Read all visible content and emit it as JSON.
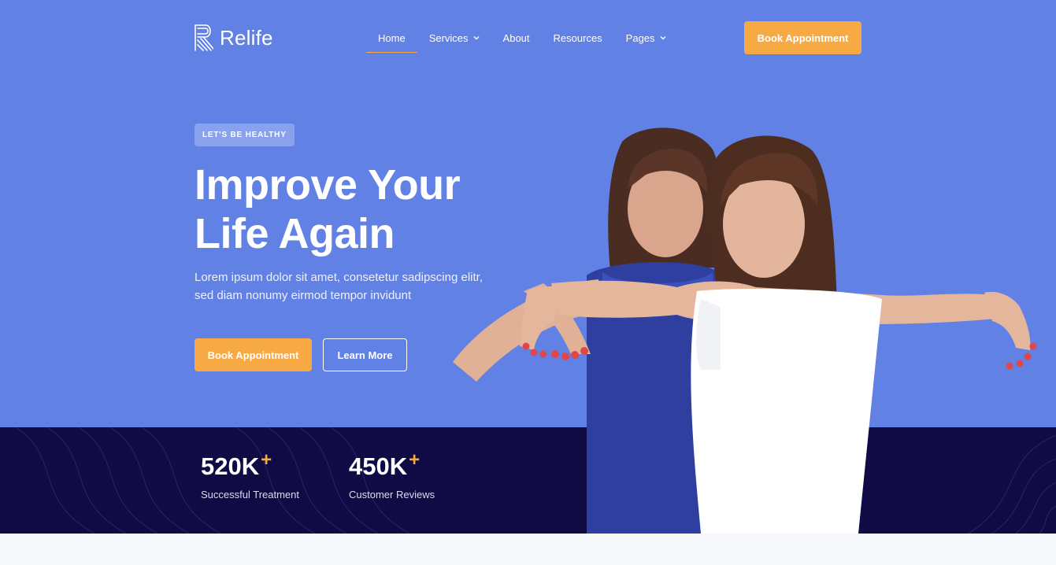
{
  "brand": {
    "name": "Relife",
    "logo_icon": "relife-logo-icon"
  },
  "nav": {
    "home": "Home",
    "services": "Services",
    "about": "About",
    "resources": "Resources",
    "pages": "Pages"
  },
  "header": {
    "cta": "Book Appointment"
  },
  "hero": {
    "badge": "LET'S BE HEALTHY",
    "title_line1": "Improve Your",
    "title_line2": "Life Again",
    "description": "Lorem ipsum dolor sit amet, consetetur sadipscing elitr, sed diam nonumy eirmod tempor invidunt",
    "primary_button": "Book Appointment",
    "secondary_button": "Learn More"
  },
  "stats": [
    {
      "value": "520K",
      "suffix": "+",
      "label": "Successful Treatment"
    },
    {
      "value": "450K",
      "suffix": "+",
      "label": "Customer Reviews"
    }
  ],
  "colors": {
    "hero_bg": "#6181e5",
    "stats_bg": "#100b45",
    "accent": "#f7a944",
    "page_bg": "#f7f8fc"
  }
}
